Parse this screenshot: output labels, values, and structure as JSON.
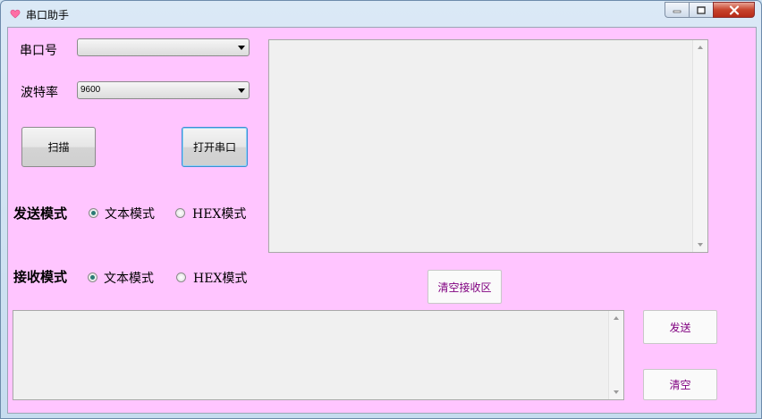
{
  "window": {
    "title": "串口助手"
  },
  "port": {
    "label": "串口号",
    "value": ""
  },
  "baud": {
    "label": "波特率",
    "value": "9600"
  },
  "buttons": {
    "scan": "扫描",
    "open_port": "打开串口",
    "clear_receive": "清空接收区",
    "send": "发送",
    "clear": "清空"
  },
  "send_mode": {
    "label": "发送模式",
    "text_option": "文本模式",
    "hex_option": "HEX模式",
    "selected": "text"
  },
  "receive_mode": {
    "label": "接收模式",
    "text_option": "文本模式",
    "hex_option": "HEX模式",
    "selected": "text"
  },
  "colors": {
    "client_bg": "#ffc5ff",
    "flat_button_text": "#800080",
    "radio_dot": "#2a7a74"
  },
  "icons": {
    "app": "heart-icon",
    "minimize": "minimize-icon",
    "maximize": "maximize-icon",
    "close": "close-icon"
  }
}
